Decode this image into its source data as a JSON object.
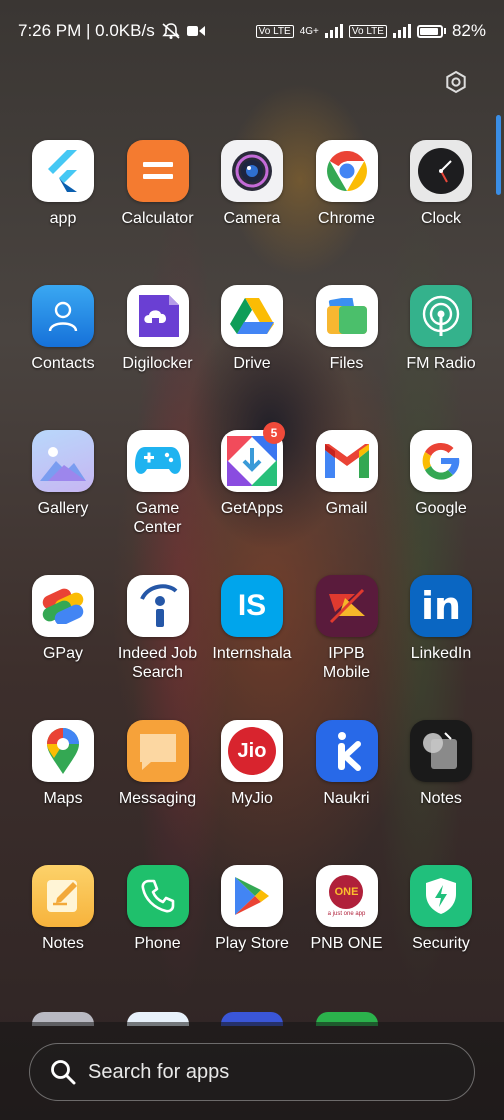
{
  "status_bar": {
    "time_and_speed": "7:26 PM | 0.0KB/s",
    "net_label": "4G+",
    "volte_label": "Vo LTE",
    "battery": "82%"
  },
  "rows": [
    [
      {
        "label": "app",
        "icon": "flutter-icon"
      },
      {
        "label": "Calculator",
        "icon": "calculator-icon"
      },
      {
        "label": "Camera",
        "icon": "camera-icon"
      },
      {
        "label": "Chrome",
        "icon": "chrome-icon"
      },
      {
        "label": "Clock",
        "icon": "clock-icon"
      }
    ],
    [
      {
        "label": "Contacts",
        "icon": "contacts-icon"
      },
      {
        "label": "Digilocker",
        "icon": "digilocker-icon"
      },
      {
        "label": "Drive",
        "icon": "drive-icon"
      },
      {
        "label": "Files",
        "icon": "files-icon"
      },
      {
        "label": "FM Radio",
        "icon": "radio-icon"
      }
    ],
    [
      {
        "label": "Gallery",
        "icon": "gallery-icon"
      },
      {
        "label": "Game\nCenter",
        "icon": "gamepad-icon"
      },
      {
        "label": "GetApps",
        "icon": "getapps-icon",
        "badge": "5"
      },
      {
        "label": "Gmail",
        "icon": "gmail-icon"
      },
      {
        "label": "Google",
        "icon": "google-icon"
      }
    ],
    [
      {
        "label": "GPay",
        "icon": "gpay-icon"
      },
      {
        "label": "Indeed Job\nSearch",
        "icon": "indeed-icon"
      },
      {
        "label": "Internshala",
        "icon": "internshala-icon"
      },
      {
        "label": "IPPB\nMobile",
        "icon": "ippb-icon"
      },
      {
        "label": "LinkedIn",
        "icon": "linkedin-icon"
      }
    ],
    [
      {
        "label": "Maps",
        "icon": "maps-icon"
      },
      {
        "label": "Messaging",
        "icon": "messaging-icon"
      },
      {
        "label": "MyJio",
        "icon": "jio-icon"
      },
      {
        "label": "Naukri",
        "icon": "naukri-icon"
      },
      {
        "label": "Notes",
        "icon": "notes-dark-icon"
      }
    ],
    [
      {
        "label": "Notes",
        "icon": "notes-icon"
      },
      {
        "label": "Phone",
        "icon": "phone-icon"
      },
      {
        "label": "Play Store",
        "icon": "play-store-icon"
      },
      {
        "label": "PNB ONE",
        "icon": "pnb-icon"
      },
      {
        "label": "Security",
        "icon": "security-icon"
      }
    ]
  ],
  "icon_text": {
    "internshala": "IS",
    "jio": "Jio",
    "linkedin": "in",
    "pnb": "ONE",
    "pnb_tagline": "a just one app"
  },
  "search": {
    "placeholder": "Search for apps"
  }
}
